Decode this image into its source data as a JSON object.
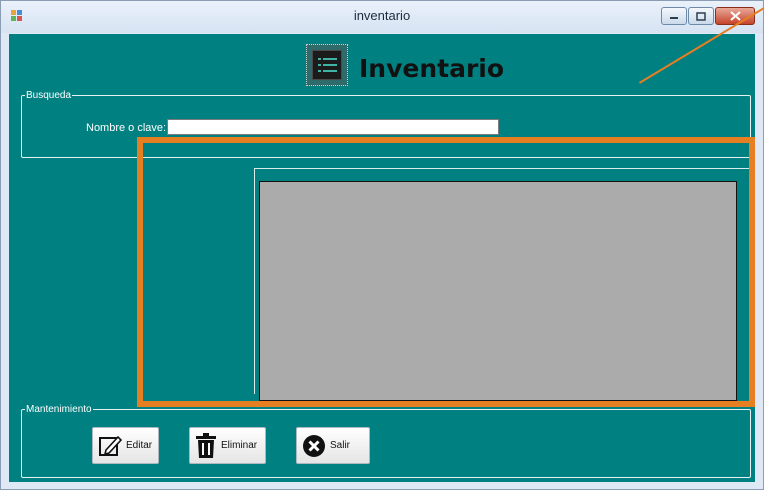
{
  "window": {
    "title": "inventario",
    "controls": [
      "minimize",
      "maximize",
      "close"
    ]
  },
  "header": {
    "title": "Inventario",
    "icon": "list-icon"
  },
  "search": {
    "group_title": "Busqueda",
    "label": "Nombre o clave:",
    "value": ""
  },
  "maintenance": {
    "group_title": "Mantenimiento",
    "buttons": [
      {
        "label": "Editar",
        "icon": "edit-icon"
      },
      {
        "label": "Eliminar",
        "icon": "trash-icon"
      },
      {
        "label": "Salir",
        "icon": "close-circle-icon"
      }
    ]
  },
  "colors": {
    "client_background": "#008080",
    "grid_background": "#ababab",
    "highlight": "#e67e22"
  }
}
